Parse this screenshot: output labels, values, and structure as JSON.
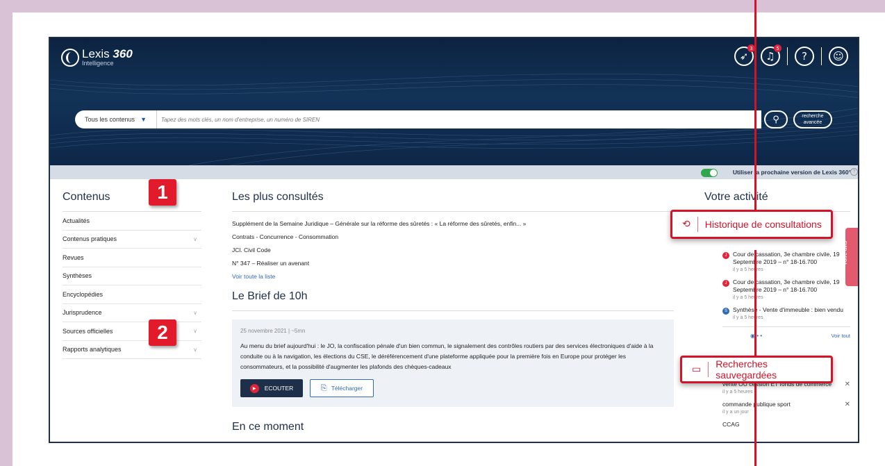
{
  "header": {
    "logo_title": "Lexis",
    "logo_number": "360",
    "logo_subtitle": "Intelligence",
    "icons": [
      {
        "name": "rocket-icon",
        "badge": "3"
      },
      {
        "name": "bell-icon",
        "badge": "5"
      },
      {
        "name": "help-icon"
      },
      {
        "name": "user-icon"
      }
    ]
  },
  "search": {
    "scope_label": "Tous les contenus",
    "placeholder": "Tapez des mots clés, un nom d'entreprise, un numéro de SIREN",
    "advanced_label_line1": "recherche",
    "advanced_label_line2": "avancée"
  },
  "subbar": {
    "next_version_label": "Utiliser la prochaine version de Lexis 360°"
  },
  "left": {
    "title": "Contenus",
    "items": [
      {
        "label": "Actualités",
        "chevron": false
      },
      {
        "label": "Contenus pratiques",
        "chevron": true
      },
      {
        "label": "Revues",
        "chevron": false
      },
      {
        "label": "Synthèses",
        "chevron": false
      },
      {
        "label": "Encyclopédies",
        "chevron": false
      },
      {
        "label": "Jurisprudence",
        "chevron": true
      },
      {
        "label": "Sources officielles",
        "chevron": true
      },
      {
        "label": "Rapports analytiques",
        "chevron": true
      }
    ]
  },
  "middle": {
    "most_consulted_title": "Les plus consultés",
    "most_consulted": [
      "Supplément de la Semaine Juridique – Générale sur la réforme des sûretés : « La réforme des sûretés, enfin... »",
      "Contrats - Concurrence - Consommation",
      "JCl. Civil Code",
      "N° 347 – Réaliser un avenant"
    ],
    "see_all_link": "Voir toute la liste",
    "brief_title": "Le Brief de 10h",
    "brief_date": "25 novembre 2021 | ~5mn",
    "brief_body": "Au menu du brief aujourd'hui : le JO, la confiscation pénale d'un bien commun, le signalement des contrôles routiers par des services électroniques d'aide à la conduite ou à la navigation, les élections du CSE, le déréférencement d'une plateforme appliquée pour la première fois en Europe pour protéger les consommateurs, et la possibilité d'augmenter les plafonds des chèques-cadeaux",
    "listen_label": "ECOUTER",
    "download_label": "Télécharger",
    "moment_title": "En ce moment"
  },
  "right": {
    "title": "Votre activité",
    "history_callout": "Historique de consultations",
    "activity": [
      {
        "text": "Cour de cassation, 3e chambre civile, 19 Septembre 2019 – n° 18-16.700",
        "time": "il y a 5 heures",
        "color": "#e0243b"
      },
      {
        "text": "Cour de cassation, 3e chambre civile, 19 Septembre 2019 – n° 18-16.700",
        "time": "il y a 5 heures",
        "color": "#e0243b"
      },
      {
        "text": "Synthèse - Vente d'immeuble : bien vendu",
        "time": "il y a 5 heures",
        "color": "#2e6bb3"
      }
    ],
    "see_all": "Voir tout",
    "saved_callout": "Recherches sauvegardées",
    "saved": [
      {
        "text": "vente OU cession ET fonds de commerce",
        "time": "il y a 5 heures"
      },
      {
        "text": "commande publique sport",
        "time": "il y a un jour"
      },
      {
        "text": "CCAG",
        "time": ""
      }
    ]
  },
  "feedback_label": "Votre avis",
  "annotations": {
    "badge1": "1",
    "badge2": "2",
    "accent_color": "#d3132a"
  }
}
